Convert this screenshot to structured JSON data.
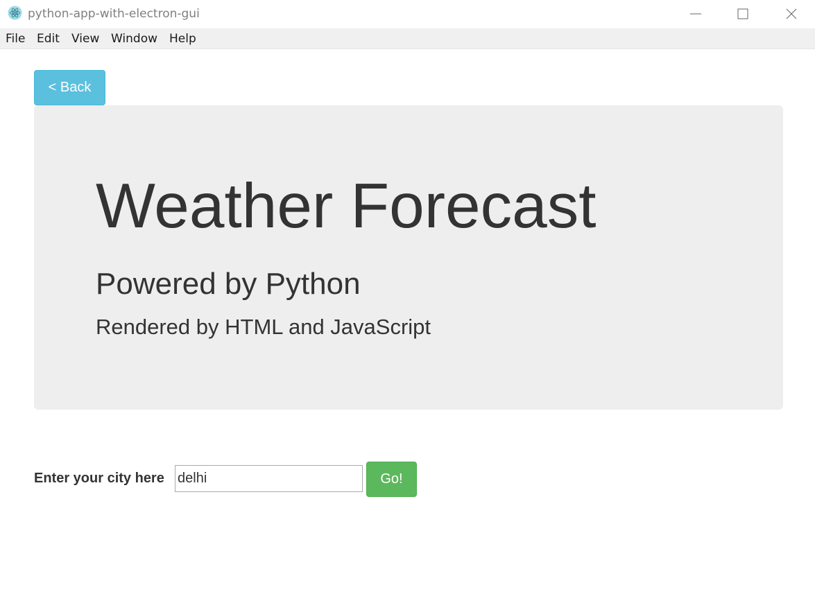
{
  "window": {
    "title": "python-app-with-electron-gui",
    "app_icon": "electron-atom-icon",
    "controls": [
      "minimize-icon",
      "maximize-icon",
      "close-icon"
    ]
  },
  "menu": {
    "items": [
      {
        "label": "File"
      },
      {
        "label": "Edit"
      },
      {
        "label": "View"
      },
      {
        "label": "Window"
      },
      {
        "label": "Help"
      }
    ]
  },
  "back_button": {
    "label": "< Back"
  },
  "jumbotron": {
    "title": "Weather Forecast",
    "subtitle": "Powered by Python",
    "tagline": "Rendered by HTML and JavaScript"
  },
  "city_form": {
    "label": "Enter your city here",
    "value": "delhi",
    "go_label": "Go!"
  },
  "colors": {
    "info": "#5bc0de",
    "success": "#5cb85c",
    "jumbotron_bg": "#eeeeee",
    "text": "#333333"
  }
}
